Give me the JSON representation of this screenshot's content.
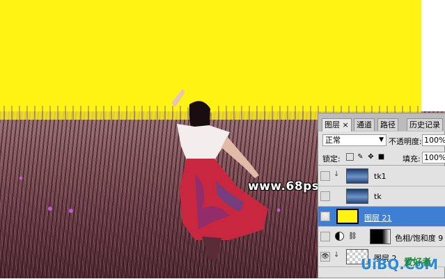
{
  "canvas": {
    "watermark": "www.68ps.com"
  },
  "panel": {
    "tabs": [
      {
        "label": "图层",
        "close": "×",
        "active": true
      },
      {
        "label": "通道",
        "active": false
      },
      {
        "label": "路径",
        "active": false
      },
      {
        "label": "历史记录",
        "active": false
      }
    ],
    "blend_mode": "正常",
    "opacity_label": "不透明度:",
    "opacity_value": "100%",
    "lock_label": "锁定:",
    "fill_label": "填充:",
    "fill_value": "100%",
    "layers": [
      {
        "name": "tk1",
        "visible": false,
        "thumb": "sky",
        "clipped": true
      },
      {
        "name": "tk",
        "visible": false,
        "thumb": "sky",
        "clipped": false
      },
      {
        "name": "图层 21",
        "visible": true,
        "thumb": "yellow",
        "selected": true
      },
      {
        "name": "色相/饱和度 9",
        "visible": false,
        "thumb": "mask",
        "adjustment": true
      },
      {
        "name": "图层 2",
        "visible": true,
        "thumb": "check",
        "clipped": true
      }
    ]
  },
  "brand": {
    "logo": "UiBQ.CoM",
    "slogan": "爱好者"
  },
  "colors": {
    "sky_yellow": "#fff313",
    "selection_blue": "#3f7fd3"
  }
}
